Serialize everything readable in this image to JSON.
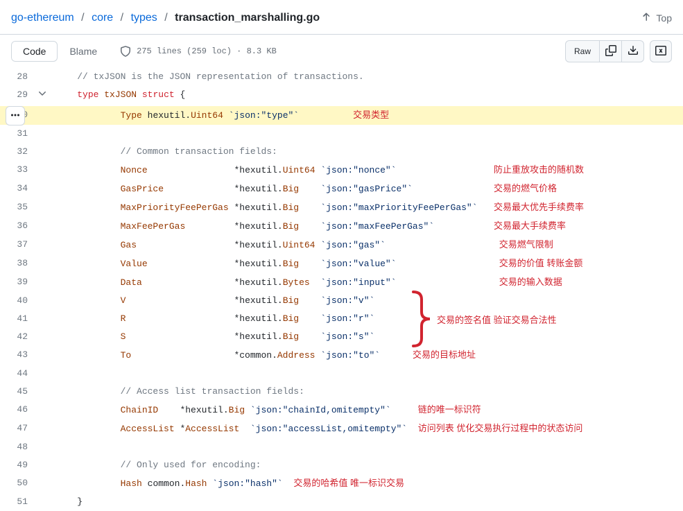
{
  "breadcrumbs": {
    "items": [
      "go-ethereum",
      "core",
      "types"
    ],
    "current": "transaction_marshalling.go"
  },
  "top_link": "Top",
  "toolbar": {
    "code_label": "Code",
    "blame_label": "Blame",
    "meta": "275 lines (259 loc) · 8.3 KB",
    "raw_label": "Raw"
  },
  "lines": [
    {
      "n": 28,
      "segs": [
        {
          "t": "    ",
          "c": ""
        },
        {
          "t": "// txJSON is the JSON representation of transactions.",
          "c": "tok-comment"
        }
      ]
    },
    {
      "n": 29,
      "fold": true,
      "segs": [
        {
          "t": "    ",
          "c": ""
        },
        {
          "t": "type",
          "c": "tok-keyword"
        },
        {
          "t": " ",
          "c": ""
        },
        {
          "t": "txJSON",
          "c": "tok-ident"
        },
        {
          "t": " ",
          "c": ""
        },
        {
          "t": "struct",
          "c": "tok-keyword"
        },
        {
          "t": " {",
          "c": ""
        }
      ]
    },
    {
      "n": 30,
      "hl": true,
      "segs": [
        {
          "t": "            ",
          "c": ""
        },
        {
          "t": "Type",
          "c": "tok-ident"
        },
        {
          "t": " hexutil.",
          "c": ""
        },
        {
          "t": "Uint64",
          "c": "tok-ident"
        },
        {
          "t": " ",
          "c": ""
        },
        {
          "t": "`json:\"type\"`",
          "c": "tok-str"
        }
      ],
      "ann": "交易类型",
      "ann_pad": "          "
    },
    {
      "n": 31,
      "segs": []
    },
    {
      "n": 32,
      "segs": [
        {
          "t": "            ",
          "c": ""
        },
        {
          "t": "// Common transaction fields:",
          "c": "tok-comment"
        }
      ]
    },
    {
      "n": 33,
      "segs": [
        {
          "t": "            ",
          "c": ""
        },
        {
          "t": "Nonce",
          "c": "tok-ident"
        },
        {
          "t": "                *hexutil.",
          "c": ""
        },
        {
          "t": "Uint64",
          "c": "tok-ident"
        },
        {
          "t": " ",
          "c": ""
        },
        {
          "t": "`json:\"nonce\"`",
          "c": "tok-str"
        }
      ],
      "ann": "防止重放攻击的随机数",
      "ann_pad": "                  "
    },
    {
      "n": 34,
      "segs": [
        {
          "t": "            ",
          "c": ""
        },
        {
          "t": "GasPrice",
          "c": "tok-ident"
        },
        {
          "t": "             *hexutil.",
          "c": ""
        },
        {
          "t": "Big",
          "c": "tok-ident"
        },
        {
          "t": "    ",
          "c": ""
        },
        {
          "t": "`json:\"gasPrice\"`",
          "c": "tok-str"
        }
      ],
      "ann": "交易的燃气价格",
      "ann_pad": "               "
    },
    {
      "n": 35,
      "segs": [
        {
          "t": "            ",
          "c": ""
        },
        {
          "t": "MaxPriorityFeePerGas",
          "c": "tok-ident"
        },
        {
          "t": " *hexutil.",
          "c": ""
        },
        {
          "t": "Big",
          "c": "tok-ident"
        },
        {
          "t": "    ",
          "c": ""
        },
        {
          "t": "`json:\"maxPriorityFeePerGas\"`",
          "c": "tok-str"
        }
      ],
      "ann": "交易最大优先手续费率",
      "ann_pad": "   "
    },
    {
      "n": 36,
      "segs": [
        {
          "t": "            ",
          "c": ""
        },
        {
          "t": "MaxFeePerGas",
          "c": "tok-ident"
        },
        {
          "t": "         *hexutil.",
          "c": ""
        },
        {
          "t": "Big",
          "c": "tok-ident"
        },
        {
          "t": "    ",
          "c": ""
        },
        {
          "t": "`json:\"maxFeePerGas\"`",
          "c": "tok-str"
        }
      ],
      "ann": "交易最大手续费率",
      "ann_pad": "           "
    },
    {
      "n": 37,
      "segs": [
        {
          "t": "            ",
          "c": ""
        },
        {
          "t": "Gas",
          "c": "tok-ident"
        },
        {
          "t": "                  *hexutil.",
          "c": ""
        },
        {
          "t": "Uint64",
          "c": "tok-ident"
        },
        {
          "t": " ",
          "c": ""
        },
        {
          "t": "`json:\"gas\"`",
          "c": "tok-str"
        }
      ],
      "ann": "交易燃气限制",
      "ann_pad": "                     "
    },
    {
      "n": 38,
      "segs": [
        {
          "t": "            ",
          "c": ""
        },
        {
          "t": "Value",
          "c": "tok-ident"
        },
        {
          "t": "                *hexutil.",
          "c": ""
        },
        {
          "t": "Big",
          "c": "tok-ident"
        },
        {
          "t": "    ",
          "c": ""
        },
        {
          "t": "`json:\"value\"`",
          "c": "tok-str"
        }
      ],
      "ann": "交易的价值 转账金额",
      "ann_pad": "                   "
    },
    {
      "n": 39,
      "segs": [
        {
          "t": "            ",
          "c": ""
        },
        {
          "t": "Data",
          "c": "tok-ident"
        },
        {
          "t": "                 *hexutil.",
          "c": ""
        },
        {
          "t": "Bytes",
          "c": "tok-ident"
        },
        {
          "t": "  ",
          "c": ""
        },
        {
          "t": "`json:\"input\"`",
          "c": "tok-str"
        }
      ],
      "ann": "交易的输入数据",
      "ann_pad": "                   "
    },
    {
      "n": 40,
      "segs": [
        {
          "t": "            ",
          "c": ""
        },
        {
          "t": "V",
          "c": "tok-ident"
        },
        {
          "t": "                    *hexutil.",
          "c": ""
        },
        {
          "t": "Big",
          "c": "tok-ident"
        },
        {
          "t": "    ",
          "c": ""
        },
        {
          "t": "`json:\"v\"`",
          "c": "tok-str"
        }
      ]
    },
    {
      "n": 41,
      "segs": [
        {
          "t": "            ",
          "c": ""
        },
        {
          "t": "R",
          "c": "tok-ident"
        },
        {
          "t": "                    *hexutil.",
          "c": ""
        },
        {
          "t": "Big",
          "c": "tok-ident"
        },
        {
          "t": "    ",
          "c": ""
        },
        {
          "t": "`json:\"r\"`",
          "c": "tok-str"
        }
      ]
    },
    {
      "n": 42,
      "segs": [
        {
          "t": "            ",
          "c": ""
        },
        {
          "t": "S",
          "c": "tok-ident"
        },
        {
          "t": "                    *hexutil.",
          "c": ""
        },
        {
          "t": "Big",
          "c": "tok-ident"
        },
        {
          "t": "    ",
          "c": ""
        },
        {
          "t": "`json:\"s\"`",
          "c": "tok-str"
        }
      ]
    },
    {
      "n": 43,
      "segs": [
        {
          "t": "            ",
          "c": ""
        },
        {
          "t": "To",
          "c": "tok-ident"
        },
        {
          "t": "                   *common.",
          "c": ""
        },
        {
          "t": "Address",
          "c": "tok-ident"
        },
        {
          "t": " ",
          "c": ""
        },
        {
          "t": "`json:\"to\"`",
          "c": "tok-str"
        }
      ],
      "ann": "交易的目标地址",
      "ann_pad": "      "
    },
    {
      "n": 44,
      "segs": []
    },
    {
      "n": 45,
      "segs": [
        {
          "t": "            ",
          "c": ""
        },
        {
          "t": "// Access list transaction fields:",
          "c": "tok-comment"
        }
      ]
    },
    {
      "n": 46,
      "segs": [
        {
          "t": "            ",
          "c": ""
        },
        {
          "t": "ChainID",
          "c": "tok-ident"
        },
        {
          "t": "    *hexutil.",
          "c": ""
        },
        {
          "t": "Big",
          "c": "tok-ident"
        },
        {
          "t": " ",
          "c": ""
        },
        {
          "t": "`json:\"chainId,omitempty\"`",
          "c": "tok-str"
        }
      ],
      "ann": "链的唯一标识符",
      "ann_pad": "     "
    },
    {
      "n": 47,
      "segs": [
        {
          "t": "            ",
          "c": ""
        },
        {
          "t": "AccessList",
          "c": "tok-ident"
        },
        {
          "t": " *",
          "c": ""
        },
        {
          "t": "AccessList",
          "c": "tok-ident"
        },
        {
          "t": "  ",
          "c": ""
        },
        {
          "t": "`json:\"accessList,omitempty\"`",
          "c": "tok-str"
        }
      ],
      "ann": "访问列表 优化交易执行过程中的状态访问",
      "ann_pad": "  "
    },
    {
      "n": 48,
      "segs": []
    },
    {
      "n": 49,
      "segs": [
        {
          "t": "            ",
          "c": ""
        },
        {
          "t": "// Only used for encoding:",
          "c": "tok-comment"
        }
      ]
    },
    {
      "n": 50,
      "segs": [
        {
          "t": "            ",
          "c": ""
        },
        {
          "t": "Hash",
          "c": "tok-ident"
        },
        {
          "t": " common.",
          "c": ""
        },
        {
          "t": "Hash",
          "c": "tok-ident"
        },
        {
          "t": " ",
          "c": ""
        },
        {
          "t": "`json:\"hash\"`",
          "c": "tok-str"
        }
      ],
      "ann": "交易的哈希值 唯一标识交易",
      "ann_pad": "  "
    },
    {
      "n": 51,
      "segs": [
        {
          "t": "    }",
          "c": ""
        }
      ]
    }
  ],
  "brace_ann": "交易的签名值 验证交易合法性"
}
